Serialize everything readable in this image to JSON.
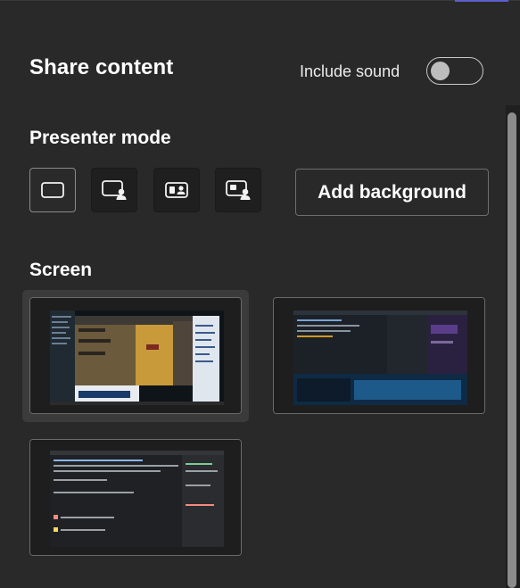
{
  "header": {
    "title": "Share content",
    "include_sound_label": "Include sound",
    "include_sound_on": false
  },
  "presenter": {
    "label": "Presenter mode",
    "modes": [
      {
        "name": "content-only",
        "icon": "screen-only-icon",
        "selected": true
      },
      {
        "name": "standout",
        "icon": "standout-icon",
        "selected": false
      },
      {
        "name": "side-by-side",
        "icon": "side-by-side-icon",
        "selected": false
      },
      {
        "name": "reporter",
        "icon": "reporter-icon",
        "selected": false
      }
    ],
    "add_background_label": "Add background"
  },
  "screens": {
    "label": "Screen",
    "items": [
      {
        "name": "screen-1",
        "selected": true
      },
      {
        "name": "screen-2",
        "selected": false
      },
      {
        "name": "screen-3",
        "selected": false
      }
    ]
  },
  "colors": {
    "background": "#292929",
    "accent": "#5b5fc7"
  }
}
